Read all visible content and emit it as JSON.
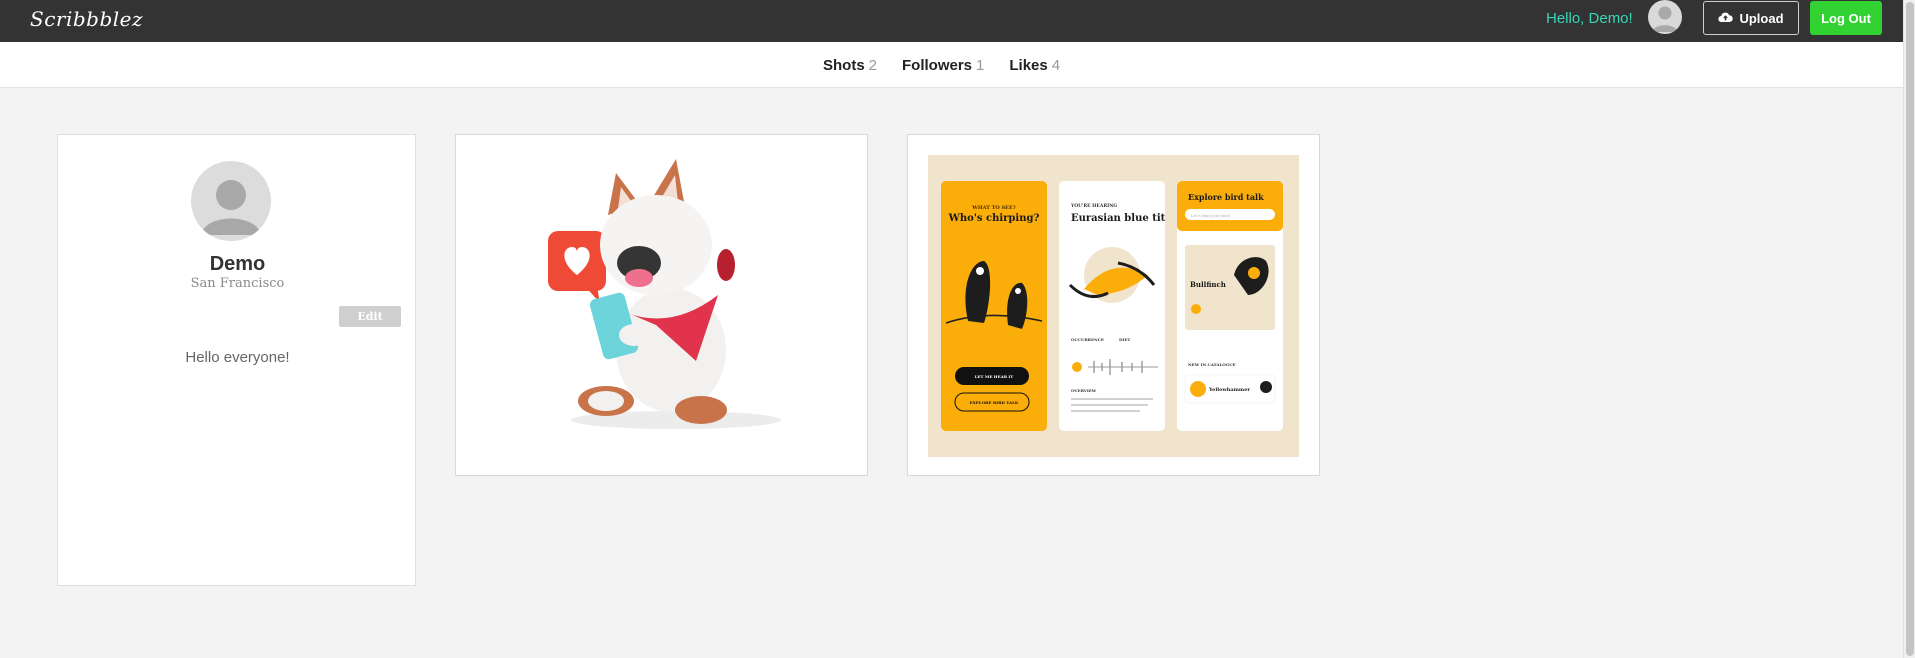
{
  "header": {
    "logo": "Scribbblez",
    "greeting": "Hello, Demo!",
    "upload_label": "Upload",
    "logout_label": "Log Out",
    "colors": {
      "bar": "#333333",
      "greeting": "#36d7b7",
      "logout": "#33d233"
    }
  },
  "stats": [
    {
      "label": "Shots",
      "count": "2"
    },
    {
      "label": "Followers",
      "count": "1"
    },
    {
      "label": "Likes",
      "count": "4"
    }
  ],
  "profile": {
    "name": "Demo",
    "location": "San Francisco",
    "edit_label": "Edit",
    "bio": "Hello everyone!"
  },
  "shots": [
    {
      "name": "shot-dog-illustration"
    },
    {
      "name": "shot-bird-app",
      "screen1": {
        "eyebrow": "WHAT TO SEE?",
        "title": "Who's chirping?",
        "btn1": "LET ME HEAR IT",
        "btn2": "EXPLORE BIRD TALK"
      },
      "screen2": {
        "eyebrow": "YOU'RE HEARING",
        "title": "Eurasian blue tit",
        "col1": "OCCURRENCE",
        "col2": "DIET",
        "overview": "OVERVIEW"
      },
      "screen3": {
        "title": "Explore bird talk",
        "search": "Let's find your bird",
        "featured": "Bullfinch",
        "catalog": "NEW IN CATALOGUE",
        "item": "Yellowhammer"
      }
    }
  ]
}
